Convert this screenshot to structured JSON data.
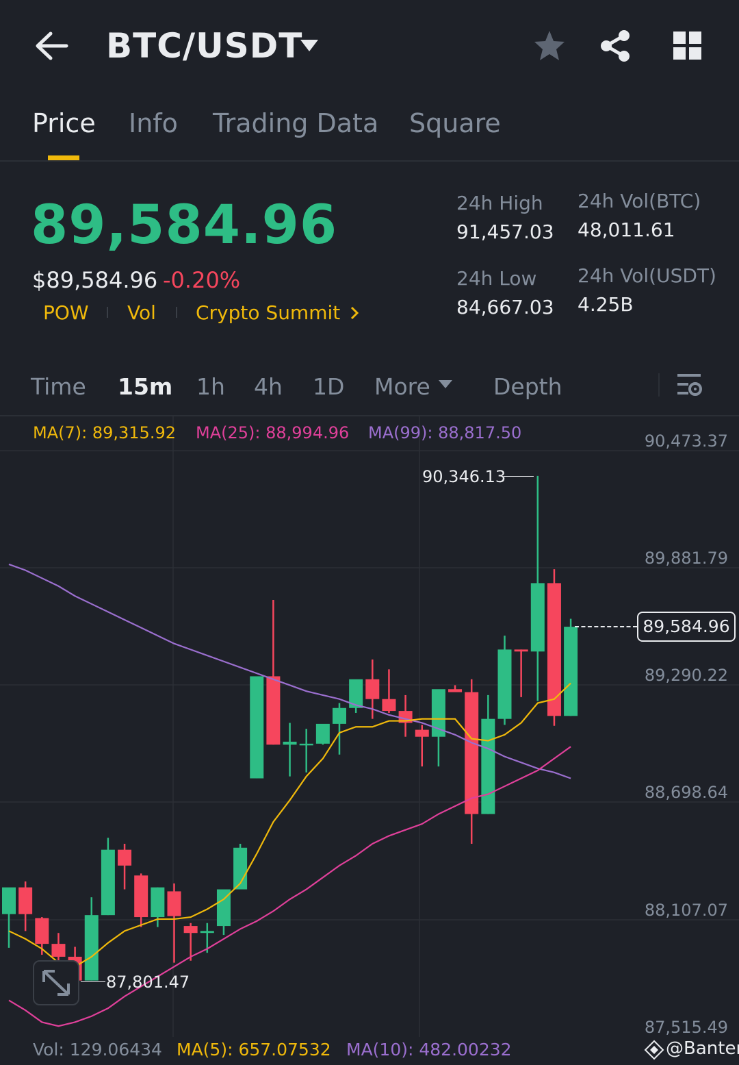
{
  "header": {
    "pair": "BTC/USDT",
    "back_icon": "arrow-left-icon",
    "dropdown_icon": "caret-down-icon",
    "favorite_icon": "star-icon",
    "share_icon": "share-icon",
    "grid_icon": "grid-icon"
  },
  "tabs": [
    {
      "label": "Price",
      "active": true
    },
    {
      "label": "Info",
      "active": false
    },
    {
      "label": "Trading Data",
      "active": false
    },
    {
      "label": "Square",
      "active": false
    }
  ],
  "price": {
    "last": "89,584.96",
    "usd": "$89,584.96",
    "change": "-0.20%"
  },
  "tags": [
    "POW",
    "Vol",
    "Crypto Summit"
  ],
  "stats": {
    "high_label": "24h High",
    "high_value": "91,457.03",
    "low_label": "24h Low",
    "low_value": "84,667.03",
    "vol_btc_label": "24h Vol(BTC)",
    "vol_btc_value": "48,011.61",
    "vol_usdt_label": "24h Vol(USDT)",
    "vol_usdt_value": "4.25B"
  },
  "timeframes": {
    "time": "Time",
    "m15": "15m",
    "h1": "1h",
    "h4": "4h",
    "d1": "1D",
    "more": "More",
    "depth": "Depth"
  },
  "indicators": {
    "ma7": "MA(7): 89,315.92",
    "ma25": "MA(25): 88,994.96",
    "ma99": "MA(99): 88,817.50",
    "vol": "Vol: 129.06434",
    "ma5": "MA(5): 657.07532",
    "ma10": "MA(10): 482.00232"
  },
  "watermark": "@Banter",
  "colors": {
    "up": "#2ebd85",
    "down": "#f6465d",
    "ma7": "#f0b90b",
    "ma25": "#e0409a",
    "ma99": "#9b6fcf",
    "accent": "#f0b90b"
  },
  "chart_data": {
    "type": "candlestick",
    "y_tick_labels": [
      "90,473.37",
      "89,881.79",
      "89,290.22",
      "88,698.64",
      "88,107.07",
      "87,515.49"
    ],
    "ylim": [
      87515.49,
      90473.37
    ],
    "high_marker": "90,346.13",
    "low_marker": "87,801.47",
    "current_price_label": "89,584.96",
    "candles": [
      {
        "o": 88135,
        "h": 88235,
        "l": 87965,
        "c": 88270
      },
      {
        "o": 88270,
        "h": 88300,
        "l": 88050,
        "c": 88135
      },
      {
        "o": 88115,
        "h": 88120,
        "l": 87930,
        "c": 87985
      },
      {
        "o": 87985,
        "h": 88040,
        "l": 87850,
        "c": 87920
      },
      {
        "o": 87920,
        "h": 87970,
        "l": 87800,
        "c": 87800
      },
      {
        "o": 87800,
        "h": 88220,
        "l": 87800,
        "c": 88130
      },
      {
        "o": 88130,
        "h": 88520,
        "l": 88130,
        "c": 88460
      },
      {
        "o": 88460,
        "h": 88490,
        "l": 88260,
        "c": 88380
      },
      {
        "o": 88330,
        "h": 88340,
        "l": 88070,
        "c": 88120
      },
      {
        "o": 88120,
        "h": 88270,
        "l": 88070,
        "c": 88270
      },
      {
        "o": 88250,
        "h": 88290,
        "l": 87890,
        "c": 88125
      },
      {
        "o": 88075,
        "h": 88090,
        "l": 87900,
        "c": 88040
      },
      {
        "o": 88040,
        "h": 88090,
        "l": 87940,
        "c": 88050
      },
      {
        "o": 88075,
        "h": 88240,
        "l": 88030,
        "c": 88260
      },
      {
        "o": 88260,
        "h": 88490,
        "l": 88260,
        "c": 88470
      },
      {
        "o": 88820,
        "h": 89335,
        "l": 88820,
        "c": 89335
      },
      {
        "o": 89335,
        "h": 89720,
        "l": 88990,
        "c": 88990
      },
      {
        "o": 88990,
        "h": 89100,
        "l": 88830,
        "c": 89005
      },
      {
        "o": 88995,
        "h": 89070,
        "l": 88850,
        "c": 88995
      },
      {
        "o": 88995,
        "h": 89030,
        "l": 88990,
        "c": 89095
      },
      {
        "o": 89095,
        "h": 89200,
        "l": 88940,
        "c": 89175
      },
      {
        "o": 89175,
        "h": 89280,
        "l": 89150,
        "c": 89320
      },
      {
        "o": 89320,
        "h": 89420,
        "l": 89120,
        "c": 89220
      },
      {
        "o": 89220,
        "h": 89370,
        "l": 89150,
        "c": 89160
      },
      {
        "o": 89160,
        "h": 89240,
        "l": 89030,
        "c": 89100
      },
      {
        "o": 89065,
        "h": 89090,
        "l": 88880,
        "c": 89030
      },
      {
        "o": 89030,
        "h": 89230,
        "l": 88880,
        "c": 89270
      },
      {
        "o": 89270,
        "h": 89290,
        "l": 89260,
        "c": 89255
      },
      {
        "o": 89255,
        "h": 89320,
        "l": 88490,
        "c": 88640
      },
      {
        "o": 88640,
        "h": 89240,
        "l": 88640,
        "c": 89120
      },
      {
        "o": 89120,
        "h": 89540,
        "l": 89090,
        "c": 89470
      },
      {
        "o": 89470,
        "h": 89470,
        "l": 89230,
        "c": 89460
      },
      {
        "o": 89460,
        "h": 90346,
        "l": 89210,
        "c": 89805
      },
      {
        "o": 89805,
        "h": 89875,
        "l": 89085,
        "c": 89135
      },
      {
        "o": 89135,
        "h": 89625,
        "l": 89135,
        "c": 89585
      }
    ],
    "ma7": [
      88050,
      88010,
      87960,
      87890,
      87870,
      87920,
      87990,
      88050,
      88080,
      88110,
      88110,
      88120,
      88160,
      88210,
      88290,
      88440,
      88600,
      88710,
      88830,
      88920,
      89050,
      89080,
      89080,
      89110,
      89110,
      89120,
      89120,
      89120,
      89020,
      89010,
      89040,
      89100,
      89200,
      89220,
      89300
    ],
    "ma25": [
      87700,
      87650,
      87590,
      87570,
      87590,
      87620,
      87660,
      87720,
      87770,
      87820,
      87870,
      87920,
      87960,
      88010,
      88060,
      88100,
      88150,
      88210,
      88260,
      88320,
      88380,
      88430,
      88490,
      88530,
      88560,
      88590,
      88640,
      88680,
      88720,
      88740,
      88780,
      88820,
      88860,
      88920,
      88980
    ],
    "ma99": [
      89900,
      89870,
      89830,
      89790,
      89740,
      89700,
      89660,
      89620,
      89580,
      89540,
      89500,
      89470,
      89440,
      89410,
      89380,
      89350,
      89320,
      89290,
      89260,
      89240,
      89220,
      89190,
      89170,
      89140,
      89120,
      89100,
      89070,
      89040,
      89000,
      88970,
      88930,
      88900,
      88870,
      88850,
      88820
    ]
  }
}
